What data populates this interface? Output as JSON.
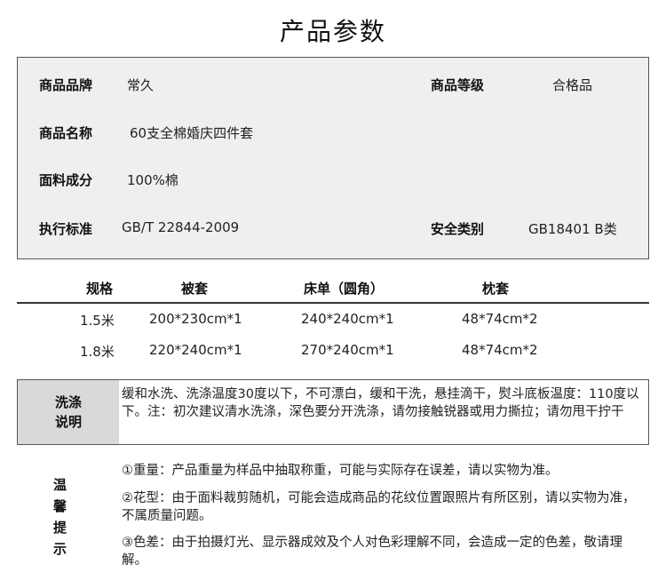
{
  "title": "产品参数",
  "params": {
    "brand_label": "商品品牌",
    "brand_value": "常久",
    "grade_label": "商品等级",
    "grade_value": "合格品",
    "name_label": "商品名称",
    "name_value": "60支全棉婚庆四件套",
    "fabric_label": "面料成分",
    "fabric_value": "100%棉",
    "standard_label": "执行标准",
    "standard_value": "GB/T 22844-2009",
    "safety_label": "安全类别",
    "safety_value": "GB18401 B类"
  },
  "spec": {
    "headers": [
      "规格",
      "被套",
      "床单（圆角）",
      "枕套"
    ],
    "rows": [
      [
        "1.5米",
        "200*230cm*1",
        "240*240cm*1",
        "48*74cm*2"
      ],
      [
        "1.8米",
        "220*240cm*1",
        "270*240cm*1",
        "48*74cm*2"
      ]
    ]
  },
  "wash": {
    "label_line1": "洗涤",
    "label_line2": "说明",
    "text": "缓和水洗、洗涤温度30度以下，不可漂白，缓和干洗，悬挂滴干，熨斗底板温度：110度以下。注：初次建议清水洗涤，深色要分开洗涤，请勿接触锐器或用力撕拉；请勿甩干拧干"
  },
  "tips": {
    "label_chars": [
      "温",
      "馨",
      "提",
      "示"
    ],
    "items": [
      "①重量：产品重量为样品中抽取称重，可能与实际存在误差，请以实物为准。",
      "②花型：由于面料裁剪随机，可能会造成商品的花纹位置跟照片有所区别，请以实物为准，不属质量问题。",
      "③色差：由于拍摄灯光、显示器成效及个人对色彩理解不同，会造成一定的色差，敬请理解。"
    ]
  }
}
